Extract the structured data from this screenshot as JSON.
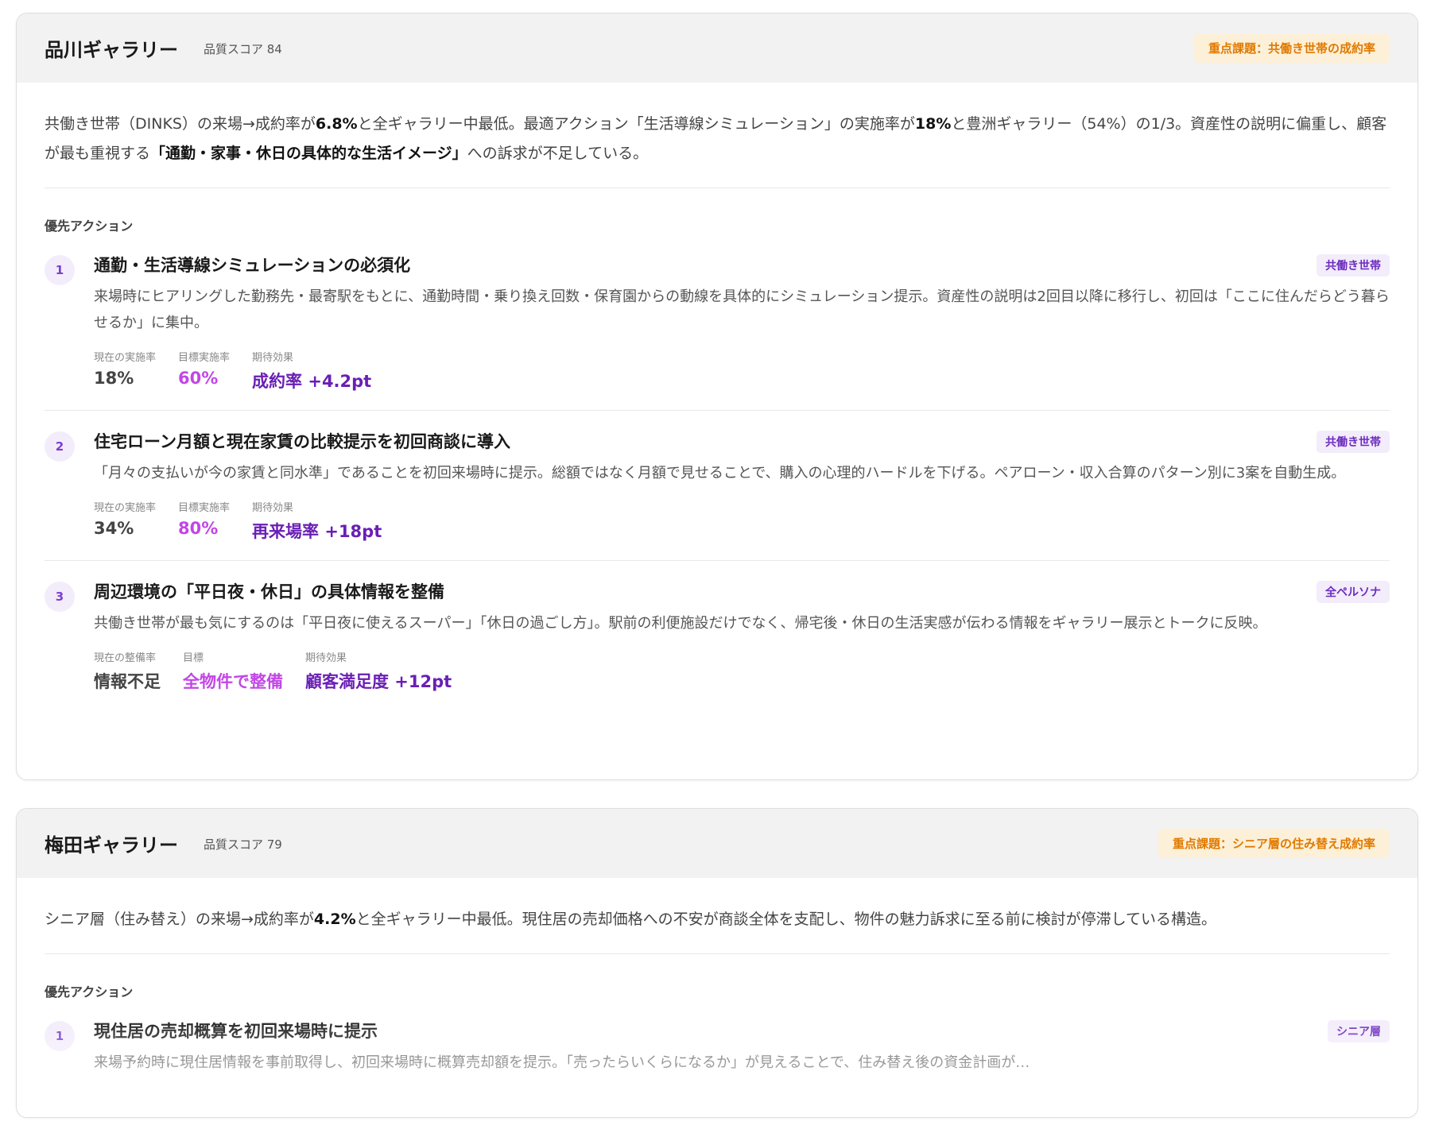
{
  "galleries": [
    {
      "name": "品川ギャラリー",
      "quality_score": "品質スコア 84",
      "focus_issue": "重点課題：共働き世帯の成約率",
      "summary": {
        "s1": "共働き世帯（DINKS）の来場→成約率が",
        "b1": "6.8%",
        "s2": "と全ギャラリー中最低。最適アクション「生活導線シミュレーション」の実施率が",
        "b2": "18%",
        "s3": "と豊洲ギャラリー（54%）の1/3。資産性の説明に偏重し、顧客が最も重視する",
        "b3": "「通勤・家事・休日の具体的な生活イメージ」",
        "s4": "への訴求が不足している。"
      },
      "section_label": "優先アクション",
      "actions": [
        {
          "num": "1",
          "title": "通勤・生活導線シミュレーションの必須化",
          "persona": "共働き世帯",
          "desc": "来場時にヒアリングした勤務先・最寄駅をもとに、通勤時間・乗り換え回数・保育園からの動線を具体的にシミュレーション提示。資産性の説明は2回目以降に移行し、初回は「ここに住んだらどう暮らせるか」に集中。",
          "current_label": "現在の実施率",
          "current_value": "18%",
          "target_label": "目標実施率",
          "target_value": "60%",
          "effect_label": "期待効果",
          "effect_value": "成約率 +4.2pt"
        },
        {
          "num": "2",
          "title": "住宅ローン月額と現在家賃の比較提示を初回商談に導入",
          "persona": "共働き世帯",
          "desc": "「月々の支払いが今の家賃と同水準」であることを初回来場時に提示。総額ではなく月額で見せることで、購入の心理的ハードルを下げる。ペアローン・収入合算のパターン別に3案を自動生成。",
          "current_label": "現在の実施率",
          "current_value": "34%",
          "target_label": "目標実施率",
          "target_value": "80%",
          "effect_label": "期待効果",
          "effect_value": "再来場率 +18pt"
        },
        {
          "num": "3",
          "title": "周辺環境の「平日夜・休日」の具体情報を整備",
          "persona": "全ペルソナ",
          "desc": "共働き世帯が最も気にするのは「平日夜に使えるスーパー」「休日の過ごし方」。駅前の利便施設だけでなく、帰宅後・休日の生活実感が伝わる情報をギャラリー展示とトークに反映。",
          "current_label": "現在の整備率",
          "current_value": "情報不足",
          "target_label": "目標",
          "target_value": "全物件で整備",
          "effect_label": "期待効果",
          "effect_value": "顧客満足度 +12pt"
        }
      ]
    },
    {
      "name": "梅田ギャラリー",
      "quality_score": "品質スコア 79",
      "focus_issue": "重点課題：シニア層の住み替え成約率",
      "summary": {
        "s1": "シニア層（住み替え）の来場→成約率が",
        "b1": "4.2%",
        "s2": "と全ギャラリー中最低。現住居の売却価格への不安が商談全体を支配し、物件の魅力訴求に至る前に検討が停滞している構造。"
      },
      "section_label": "優先アクション",
      "actions": [
        {
          "num": "1",
          "title": "現住居の売却概算を初回来場時に提示",
          "persona": "シニア層",
          "desc": "来場予約時に現住居情報を事前取得し、初回来場時に概算売却額を提示。「売ったらいくらになるか」が見えることで、住み替え後の資金計画が…"
        }
      ]
    }
  ]
}
